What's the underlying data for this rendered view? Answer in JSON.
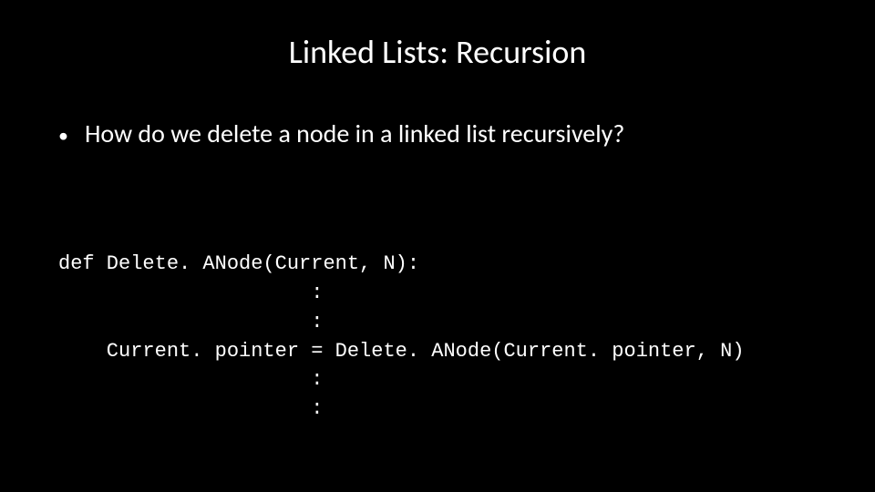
{
  "title": "Linked Lists: Recursion",
  "bullet": {
    "dot": "•",
    "text": "How do we delete a node in a linked list recursively?"
  },
  "code": {
    "line1": "def Delete. ANode(Current, N):",
    "line2": "                     :",
    "line3": "                     :",
    "line4": "    Current. pointer = Delete. ANode(Current. pointer, N)",
    "line5": "                     :",
    "line6": "                     :"
  }
}
